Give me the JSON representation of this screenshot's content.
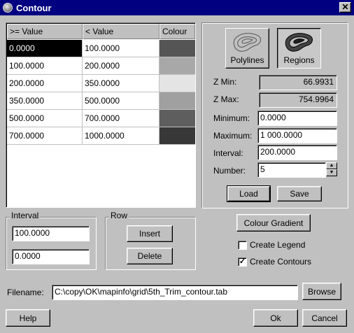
{
  "window": {
    "title": "Contour"
  },
  "table": {
    "headers": [
      ">= Value",
      "< Value",
      "Colour"
    ],
    "rows": [
      {
        "from": "0.0000",
        "to": "100.0000",
        "colour": "#555555"
      },
      {
        "from": "100.0000",
        "to": "200.0000",
        "colour": "#a8a8a8"
      },
      {
        "from": "200.0000",
        "to": "350.0000",
        "colour": "#e4e4e4"
      },
      {
        "from": "350.0000",
        "to": "500.0000",
        "colour": "#a0a0a0"
      },
      {
        "from": "500.0000",
        "to": "700.0000",
        "colour": "#5e5e5e"
      },
      {
        "from": "700.0000",
        "to": "1000.0000",
        "colour": "#383838"
      }
    ],
    "selected_row": 0
  },
  "type_buttons": {
    "polylines": "Polylines",
    "regions": "Regions"
  },
  "stats": {
    "zmin_label": "Z Min:",
    "zmin_value": "66.9931",
    "zmax_label": "Z Max:",
    "zmax_value": "754.9964"
  },
  "params": {
    "minimum_label": "Minimum:",
    "minimum_value": "0.0000",
    "maximum_label": "Maximum:",
    "maximum_value": "1 000.0000",
    "interval_label": "Interval:",
    "interval_value": "200.0000",
    "number_label": "Number:",
    "number_value": "5"
  },
  "buttons": {
    "load": "Load",
    "save": "Save",
    "colour_gradient": "Colour Gradient",
    "insert": "Insert",
    "delete": "Delete",
    "browse": "Browse",
    "help": "Help",
    "ok": "Ok",
    "cancel": "Cancel"
  },
  "interval_group": {
    "label": "Interval",
    "value1": "100.0000",
    "value2": "0.0000"
  },
  "row_group": {
    "label": "Row"
  },
  "options": {
    "create_legend": "Create Legend",
    "create_legend_checked": false,
    "create_contours": "Create Contours",
    "create_contours_checked": true
  },
  "filename": {
    "label": "Filename:",
    "value": "C:\\copy\\OK\\mapinfo\\grid\\5th_Trim_contour.tab"
  }
}
